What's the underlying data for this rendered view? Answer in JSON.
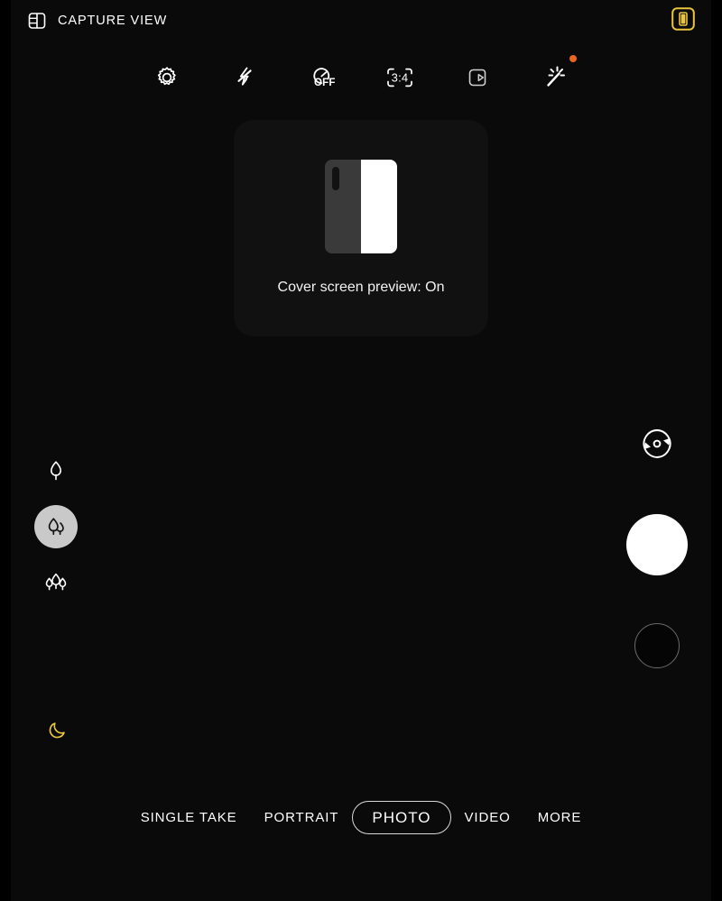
{
  "topbar": {
    "capture_view_icon": "capture-view-split-icon",
    "capture_view_label": "CAPTURE VIEW",
    "cover_badge_icon": "cover-screen-badge-icon",
    "cover_badge_color": "#e8c53c"
  },
  "toolbar": {
    "items": [
      {
        "name": "settings",
        "icon": "gear-icon",
        "label": ""
      },
      {
        "name": "flash",
        "icon": "flash-off-icon",
        "label": ""
      },
      {
        "name": "timer",
        "icon": "timer-icon",
        "label": "OFF"
      },
      {
        "name": "aspect-ratio",
        "icon": "aspect-ratio-icon",
        "label": "3:4"
      },
      {
        "name": "motion-photo",
        "icon": "motion-photo-icon",
        "label": ""
      },
      {
        "name": "filters",
        "icon": "magic-wand-icon",
        "label": "",
        "badge": true
      }
    ],
    "badge_color": "#e8661e"
  },
  "cover_popup": {
    "text": "Cover screen preview: On",
    "graphic": "foldable-phone-icon",
    "left_panel_color": "#3a3a3a",
    "right_panel_color": "#ffffff"
  },
  "lens_rail": {
    "items": [
      {
        "name": "zoom-telephoto",
        "icon": "one-leaf-icon",
        "selected": false
      },
      {
        "name": "zoom-wide",
        "icon": "two-leaves-icon",
        "selected": true
      },
      {
        "name": "zoom-ultrawide",
        "icon": "three-leaves-icon",
        "selected": false
      }
    ],
    "selected_bg": "#c9c9c9"
  },
  "night_indicator": {
    "icon": "crescent-moon-icon",
    "color": "#e8c53c"
  },
  "capture_controls": {
    "switch_camera_icon": "switch-camera-icon",
    "shutter_icon": "shutter-button",
    "shutter_color": "#ffffff",
    "gallery_icon": "gallery-thumbnail"
  },
  "mode_bar": {
    "modes": [
      {
        "label": "SINGLE TAKE",
        "active": false
      },
      {
        "label": "PORTRAIT",
        "active": false
      },
      {
        "label": "PHOTO",
        "active": true
      },
      {
        "label": "VIDEO",
        "active": false
      },
      {
        "label": "MORE",
        "active": false
      }
    ]
  }
}
